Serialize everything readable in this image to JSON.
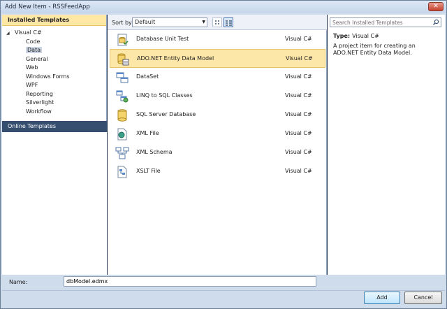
{
  "window": {
    "title": "Add New Item - RSSFeedApp",
    "close_glyph": "✕"
  },
  "left": {
    "installed_header": "Installed Templates",
    "root": {
      "label": "Visual C#",
      "arrow": "◢"
    },
    "children": [
      "Code",
      "Data",
      "General",
      "Web",
      "Windows Forms",
      "WPF",
      "Reporting",
      "Silverlight",
      "Workflow"
    ],
    "selected_child": "Data",
    "online_header": "Online Templates"
  },
  "toolbar": {
    "sort_label": "Sort by:",
    "sort_value": "Default",
    "chevron": "▼"
  },
  "items": [
    {
      "name": "Database Unit Test",
      "lang": "Visual C#",
      "icon": "database-unit-test-icon"
    },
    {
      "name": "ADO.NET Entity Data Model",
      "lang": "Visual C#",
      "icon": "entity-data-model-icon",
      "selected": true
    },
    {
      "name": "DataSet",
      "lang": "Visual C#",
      "icon": "dataset-icon"
    },
    {
      "name": "LINQ to SQL Classes",
      "lang": "Visual C#",
      "icon": "linq-to-sql-icon"
    },
    {
      "name": "SQL Server Database",
      "lang": "Visual C#",
      "icon": "sql-database-icon"
    },
    {
      "name": "XML File",
      "lang": "Visual C#",
      "icon": "xml-file-icon"
    },
    {
      "name": "XML Schema",
      "lang": "Visual C#",
      "icon": "xml-schema-icon"
    },
    {
      "name": "XSLT File",
      "lang": "Visual C#",
      "icon": "xslt-file-icon"
    }
  ],
  "details": {
    "search_placeholder": "Search Installed Templates",
    "type_label": "Type:",
    "type_value": "Visual C#",
    "description": "A project item for creating an ADO.NET Entity Data Model."
  },
  "bottom": {
    "name_label": "Name:",
    "name_value": "dbModel.edmx",
    "add_label": "Add",
    "cancel_label": "Cancel"
  },
  "colors": {
    "selection": "#fde7a8",
    "online_header_bg": "#364e6f",
    "frame": "#293955"
  }
}
